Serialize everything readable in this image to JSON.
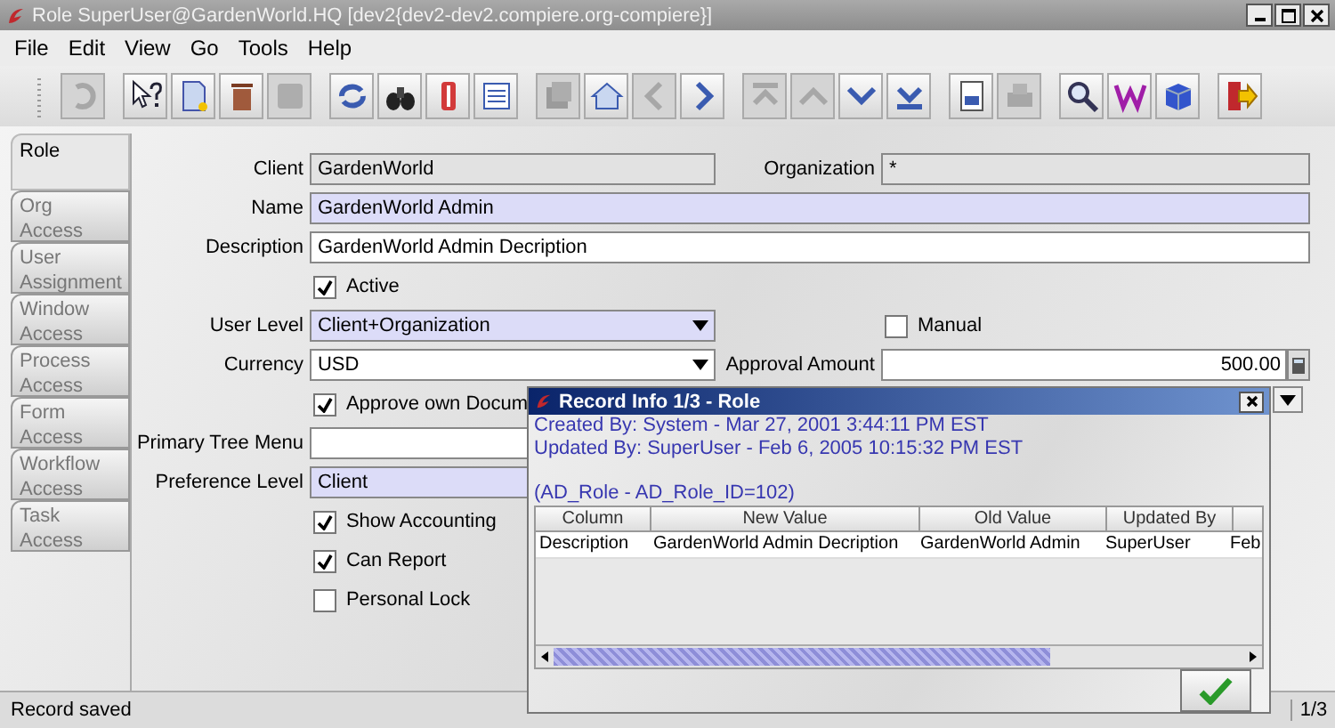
{
  "window": {
    "title": "Role  SuperUser@GardenWorld.HQ [dev2{dev2-dev2.compiere.org-compiere}]"
  },
  "menu": [
    "File",
    "Edit",
    "View",
    "Go",
    "Tools",
    "Help"
  ],
  "toolbar": [
    [
      {
        "kind": "undo",
        "disabled": true
      }
    ],
    [
      {
        "kind": "help",
        "disabled": false
      },
      {
        "kind": "new",
        "disabled": false
      },
      {
        "kind": "delete",
        "disabled": false
      },
      {
        "kind": "save",
        "disabled": true
      }
    ],
    [
      {
        "kind": "refresh",
        "disabled": false
      },
      {
        "kind": "find",
        "disabled": false
      },
      {
        "kind": "attachment",
        "disabled": false
      },
      {
        "kind": "grid",
        "disabled": false
      }
    ],
    [
      {
        "kind": "parent",
        "disabled": true
      },
      {
        "kind": "home",
        "disabled": false
      },
      {
        "kind": "back",
        "disabled": true
      },
      {
        "kind": "forward",
        "disabled": false
      }
    ],
    [
      {
        "kind": "first",
        "disabled": true
      },
      {
        "kind": "previous",
        "disabled": true
      },
      {
        "kind": "next",
        "disabled": false
      },
      {
        "kind": "last",
        "disabled": false
      }
    ],
    [
      {
        "kind": "report",
        "disabled": false
      },
      {
        "kind": "print",
        "disabled": true
      }
    ],
    [
      {
        "kind": "zoom",
        "disabled": false
      },
      {
        "kind": "workflow",
        "disabled": false
      },
      {
        "kind": "product",
        "disabled": false
      }
    ],
    [
      {
        "kind": "exit",
        "disabled": false
      }
    ]
  ],
  "tabs": [
    {
      "label": "Role",
      "selected": true
    },
    {
      "label": "Org Access",
      "selected": false
    },
    {
      "label": "User Assignment",
      "selected": false
    },
    {
      "label": "Window Access",
      "selected": false
    },
    {
      "label": "Process Access",
      "selected": false
    },
    {
      "label": "Form Access",
      "selected": false
    },
    {
      "label": "Workflow Access",
      "selected": false
    },
    {
      "label": "Task Access",
      "selected": false
    }
  ],
  "rows": [
    {
      "kind": "text",
      "label": "Client",
      "value": "GardenWorld",
      "readonly": true,
      "mandatory": false,
      "right": {
        "kind": "text",
        "label": "Organization",
        "value": "*",
        "readonly": true,
        "mandatory": false
      }
    },
    {
      "kind": "text",
      "label": "Name",
      "value": "GardenWorld Admin",
      "readonly": false,
      "mandatory": true,
      "wide": true
    },
    {
      "kind": "text",
      "label": "Description",
      "value": "GardenWorld Admin Decription",
      "readonly": false,
      "mandatory": false,
      "wide": true
    },
    {
      "kind": "checkbox",
      "label": "Active",
      "checked": true
    },
    {
      "kind": "select",
      "label": "User Level",
      "value": "Client+Organization",
      "readonly": false,
      "mandatory": true,
      "right": {
        "kind": "checkbox",
        "label": "Manual",
        "checked": false
      }
    },
    {
      "kind": "select",
      "label": "Currency",
      "value": "USD",
      "readonly": false,
      "mandatory": false,
      "right": {
        "kind": "amount",
        "label": "Approval Amount",
        "value": "500.00",
        "readonly": false,
        "mandatory": false
      }
    },
    {
      "kind": "checkbox",
      "label": "Approve own Docum",
      "checked": true
    },
    {
      "kind": "text",
      "label": "Primary Tree Menu",
      "readonly": false,
      "mandatory": false,
      "wide": false
    },
    {
      "kind": "text",
      "label": "Preference Level",
      "value": "Client",
      "readonly": false,
      "mandatory": true,
      "wide": false
    },
    {
      "kind": "checkbox",
      "label": "Show Accounting",
      "checked": true
    },
    {
      "kind": "checkbox",
      "label": "Can Report",
      "checked": true
    },
    {
      "kind": "checkbox",
      "label": "Personal Lock",
      "checked": false
    }
  ],
  "record_info": {
    "title": "Record Info  1/3 - Role",
    "lines": [
      "Created By: System - Mar 27, 2001 3:44:11 PM EST",
      "Updated By: SuperUser - Feb 6, 2005 10:15:32 PM EST"
    ],
    "table_ref": "(AD_Role - AD_Role_ID=102)",
    "columns": [
      "Column",
      "New Value",
      "Old Value",
      "Updated By"
    ],
    "rows": [
      [
        "Description",
        "GardenWorld Admin Decription",
        "GardenWorld Admin",
        "SuperUser",
        "Feb"
      ]
    ]
  },
  "status_bar": {
    "message": "Record saved",
    "record": "1/3"
  }
}
